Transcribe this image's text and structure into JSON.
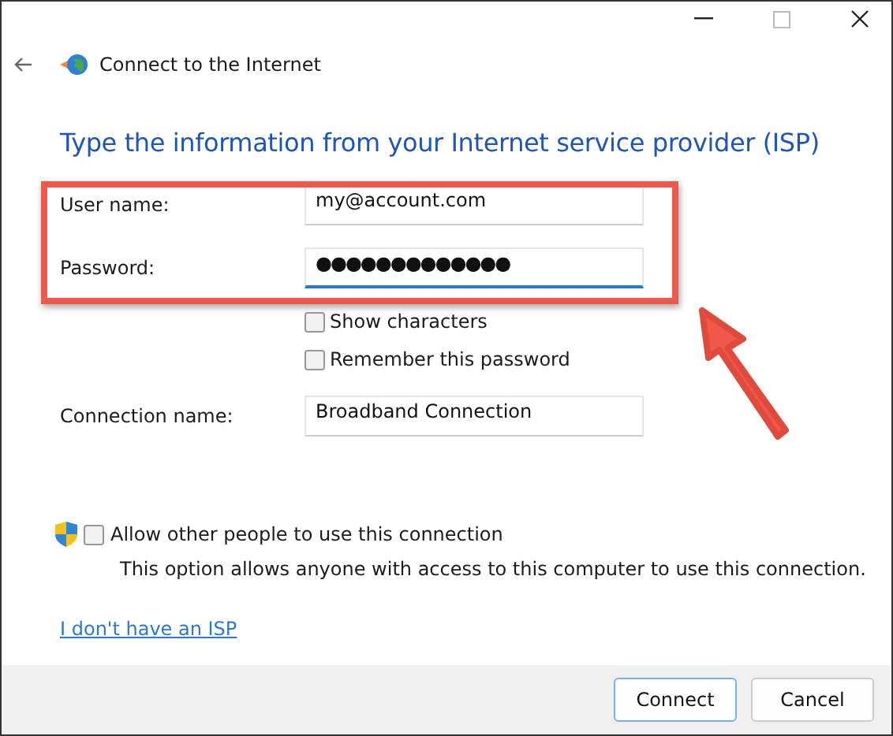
{
  "window": {
    "title": "Connect to the Internet"
  },
  "heading": "Type the information from your Internet service provider (ISP)",
  "fields": [
    {
      "label": "User name:",
      "value": "my@account.com",
      "focused": false
    },
    {
      "label": "Password:",
      "value": "●●●●●●●●●●●●●",
      "focused": true
    }
  ],
  "checkboxes": [
    {
      "label": "Show characters",
      "checked": false
    },
    {
      "label": "Remember this password",
      "checked": false
    }
  ],
  "connection_name": {
    "label": "Connection name:",
    "value": "Broadband Connection"
  },
  "allow_others": {
    "label": "Allow other people to use this connection",
    "checked": false,
    "description": "This option allows anyone with access to this computer to use this connection."
  },
  "link": "I don't have an ISP",
  "buttons": [
    {
      "label": "Connect",
      "default": true
    },
    {
      "label": "Cancel",
      "default": false
    }
  ]
}
